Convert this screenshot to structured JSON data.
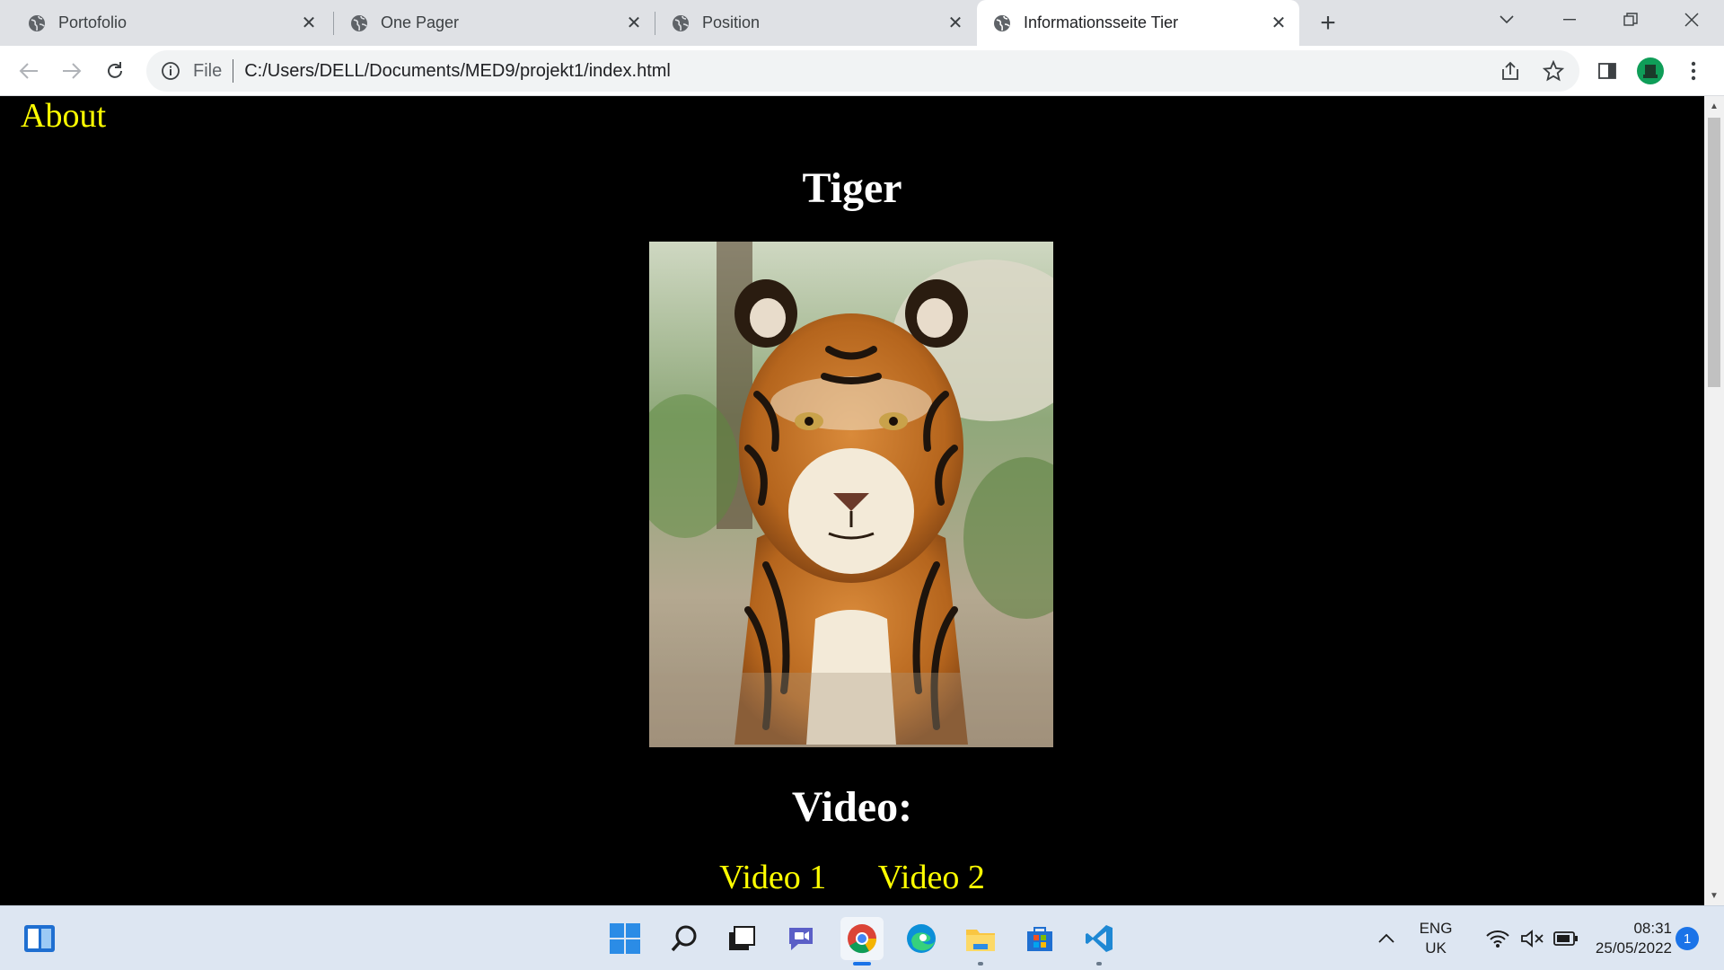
{
  "browser": {
    "tabs": [
      {
        "label": "Portofolio",
        "active": false
      },
      {
        "label": "One Pager",
        "active": false
      },
      {
        "label": "Position",
        "active": false
      },
      {
        "label": "Informationsseite Tier",
        "active": true
      }
    ],
    "address": {
      "security_label": "File",
      "url": "C:/Users/DELL/Documents/MED9/projekt1/index.html"
    }
  },
  "page": {
    "about_link": "About",
    "title": "Tiger",
    "image_subject": "tiger-photo",
    "video_heading": "Video:",
    "video_links": [
      "Video 1",
      "Video 2"
    ],
    "link_color": "#ffff00",
    "background_color": "#000000"
  },
  "taskbar": {
    "apps": [
      "start",
      "search",
      "task-view",
      "chat",
      "chrome",
      "edge",
      "file-explorer",
      "store",
      "vscode"
    ],
    "language": {
      "line1": "ENG",
      "line2": "UK"
    },
    "clock": {
      "time": "08:31",
      "date": "25/05/2022"
    },
    "notification_count": "1"
  }
}
